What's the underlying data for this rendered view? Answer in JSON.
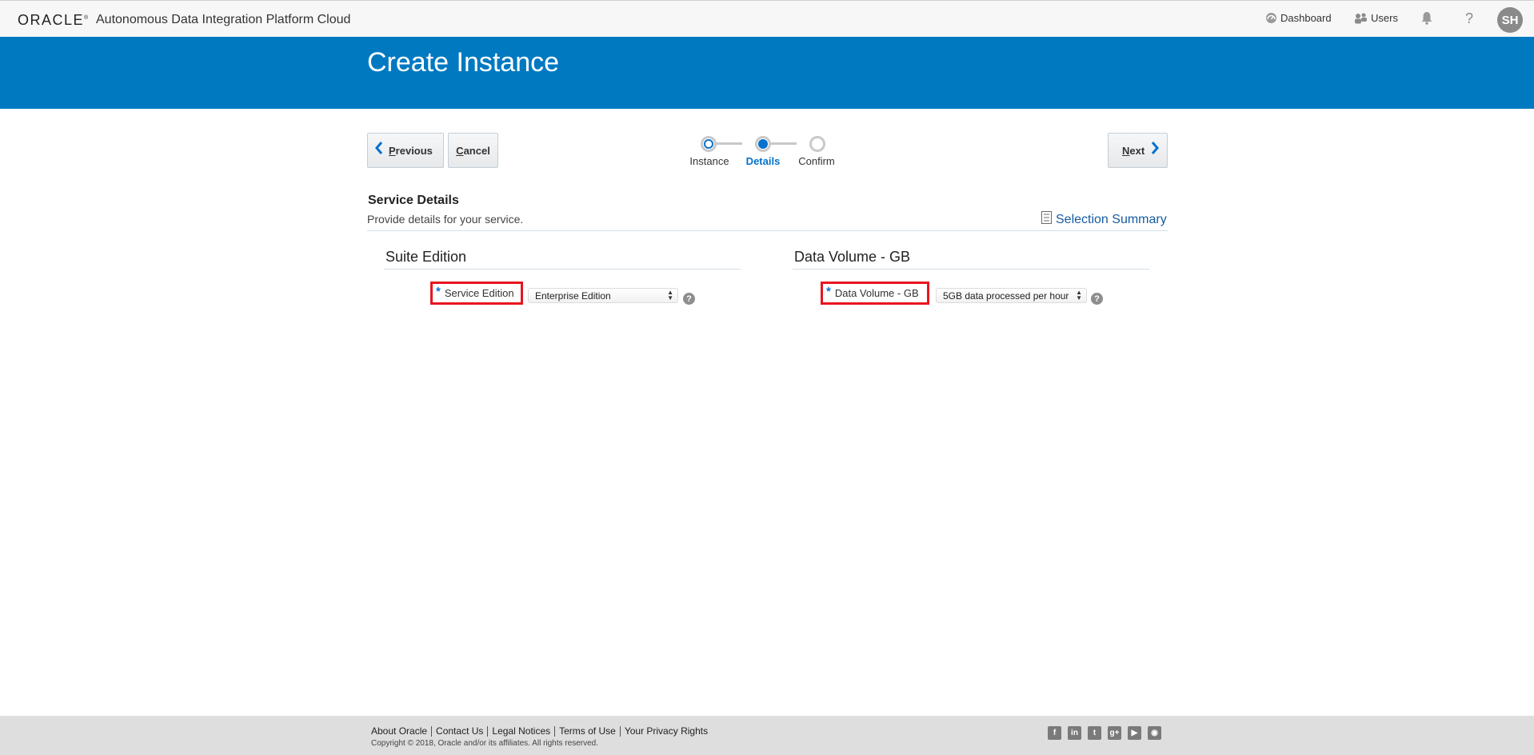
{
  "topbar": {
    "logo": "ORACLE",
    "app_title": "Autonomous Data Integration Platform Cloud",
    "nav": {
      "dashboard": "Dashboard",
      "users": "Users"
    },
    "help_glyph": "?",
    "avatar_initials": "SH"
  },
  "header": {
    "title": "Create Instance"
  },
  "train": {
    "previous_label": "Previous",
    "cancel_label": "Cancel",
    "next_label": "Next",
    "steps": [
      {
        "label": "Instance",
        "state": "visited"
      },
      {
        "label": "Details",
        "state": "current"
      },
      {
        "label": "Confirm",
        "state": "unvisited"
      }
    ]
  },
  "section": {
    "title": "Service Details",
    "description": "Provide details for your service.",
    "summary_link": "Selection Summary"
  },
  "groups": [
    {
      "title": "Suite Edition",
      "field_label": "Service Edition",
      "required_mark": "*",
      "selected_value": "Enterprise Edition",
      "help_glyph": "?"
    },
    {
      "title": "Data Volume - GB",
      "field_label": "Data Volume - GB",
      "required_mark": "*",
      "selected_value": "5GB data processed per hour",
      "help_glyph": "?"
    }
  ],
  "footer": {
    "links": [
      "About Oracle",
      "Contact Us",
      "Legal Notices",
      "Terms of Use",
      "Your Privacy Rights"
    ],
    "copyright": "Copyright © 2018, Oracle and/or its affiliates. All rights reserved.",
    "social_icons": [
      "facebook-icon",
      "linkedin-icon",
      "twitter-icon",
      "google-plus-icon",
      "youtube-icon",
      "rss-icon"
    ]
  },
  "colors": {
    "banner": "#0079c1",
    "accent": "#0572ce",
    "highlight_box": "#e8151f",
    "footer_bg": "#dedede"
  }
}
